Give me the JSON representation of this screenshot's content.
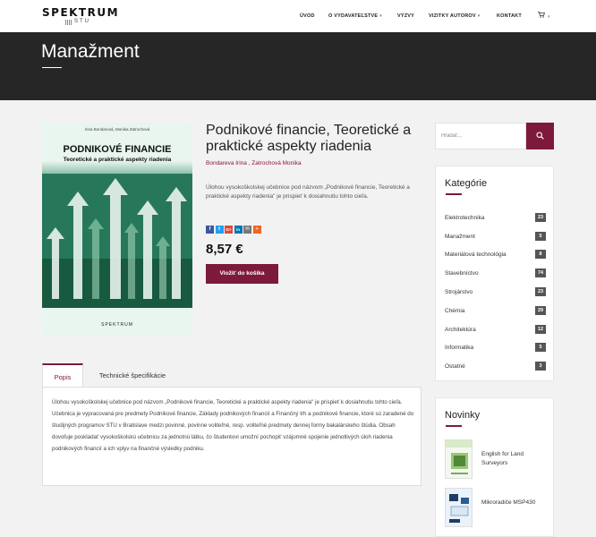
{
  "header": {
    "logo_main": "SPEKTRUM",
    "logo_sub": "STU",
    "nav": [
      {
        "label": "ÚVOD",
        "has_caret": false
      },
      {
        "label": "O VYDAVATEĽSTVE",
        "has_caret": true
      },
      {
        "label": "VÝZVY",
        "has_caret": false
      },
      {
        "label": "VIZITKY AUTOROV",
        "has_caret": true
      },
      {
        "label": "KONTAKT",
        "has_caret": false
      }
    ],
    "cart_icon": "cart-icon"
  },
  "banner": {
    "title": "Manažment"
  },
  "cover": {
    "authors": "Irina Bondarová, Monika Zatrochová",
    "title": "PODNIKOVÉ FINANCIE",
    "subtitle": "Teoretické a praktické aspekty riadenia",
    "publisher": "SPEKTRUM"
  },
  "product": {
    "title": "Podnikové financie, Teoretické a praktické aspekty riadenia",
    "authors": "Bondareva Irina , Zatrochová Monika",
    "description": "Úlohou vysokoškolskej učebnice pod názvom „Podnikové financie, Teoretické a praktické aspekty riadenia\" je prispieť k dosiahnutiu tohto cieľa.",
    "price": "8,57 €",
    "add_to_cart": "Vložiť do košíka",
    "share_icons": [
      {
        "name": "facebook-icon",
        "glyph": "f",
        "color": "#3b5998"
      },
      {
        "name": "twitter-icon",
        "glyph": "t",
        "color": "#1da1f2"
      },
      {
        "name": "googleplus-icon",
        "glyph": "G+",
        "color": "#dd4b39"
      },
      {
        "name": "linkedin-icon",
        "glyph": "in",
        "color": "#0077b5"
      },
      {
        "name": "email-icon",
        "glyph": "✉",
        "color": "#777777"
      },
      {
        "name": "more-share-icon",
        "glyph": "+",
        "color": "#f26522"
      }
    ]
  },
  "tabs": {
    "items": [
      "Popis",
      "Technické špecifikácie"
    ],
    "description": "Úlohou vysokoškolskej učebnice pod názvom „Podnikové financie, Teoretické a praktické aspekty riadenia\" je prispieť k dosiahnutiu tohto cieľa. Učebnica je vypracovaná pre predmety Podnikové financie, Základy podnikových financií a Finančný trh a podnikové financie, ktoré sú zaradené do študijných programov STU v Bratislave medzi povinné, povinne voliteľné, resp. voliteľné predmety dennej formy bakalárskeho štúdia. Obsah dovoľuje poskladať vysokoškolskú učebnicu za jednotnú látku, čo študentovi umožní pochopiť vzájomné spojenie jednotlivých úloh riadenia podnikových financií a ich vplyv na finančné výsledky podniku."
  },
  "sidebar": {
    "search_placeholder": "Hľadať...",
    "categories_title": "Kategórie",
    "categories": [
      {
        "label": "Elektrotechnika",
        "count": "23"
      },
      {
        "label": "Manažment",
        "count": "5"
      },
      {
        "label": "Materiálová technológia",
        "count": "8"
      },
      {
        "label": "Stavebníctvo",
        "count": "74"
      },
      {
        "label": "Strojárstvo",
        "count": "23"
      },
      {
        "label": "Chémia",
        "count": "29"
      },
      {
        "label": "Architektúra",
        "count": "12"
      },
      {
        "label": "Informatika",
        "count": "5"
      },
      {
        "label": "Ostatné",
        "count": "3"
      }
    ],
    "news_title": "Novinky",
    "news": [
      {
        "label": "English for Land Surveyors"
      },
      {
        "label": "Mikroradiče MSP430"
      }
    ]
  },
  "colors": {
    "accent": "#7d1a3c",
    "banner": "#262626",
    "background": "#f2f2f2"
  }
}
